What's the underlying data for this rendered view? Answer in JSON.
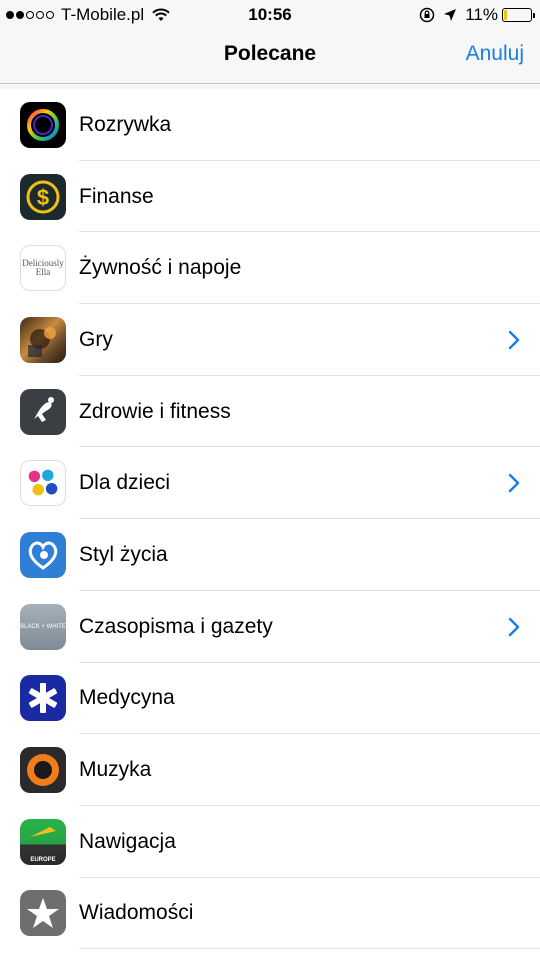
{
  "status_bar": {
    "carrier": "T-Mobile.pl",
    "time": "10:56",
    "battery": "11%",
    "battery_color": "#f5c400"
  },
  "nav": {
    "title": "Polecane",
    "cancel_label": "Anuluj",
    "accent_color": "#1a7ee6"
  },
  "categories": [
    {
      "label": "Rozrywka",
      "icon": "rozrywka-icon",
      "has_chevron": false
    },
    {
      "label": "Finanse",
      "icon": "dollar-coin-icon",
      "has_chevron": false
    },
    {
      "label": "Żywność i napoje",
      "icon": "deliciously-ella-icon",
      "icon_text": "Deliciously Ella",
      "has_chevron": false
    },
    {
      "label": "Gry",
      "icon": "game-character-icon",
      "has_chevron": true
    },
    {
      "label": "Zdrowie i fitness",
      "icon": "runner-icon",
      "has_chevron": false
    },
    {
      "label": "Dla dzieci",
      "icon": "handprints-icon",
      "has_chevron": true
    },
    {
      "label": "Styl życia",
      "icon": "heart-baby-icon",
      "has_chevron": false
    },
    {
      "label": "Czasopisma i gazety",
      "icon": "black-white-magazine-icon",
      "icon_text": "BLACK + WHITE",
      "has_chevron": true
    },
    {
      "label": "Medycyna",
      "icon": "star-of-life-icon",
      "has_chevron": false
    },
    {
      "label": "Muzyka",
      "icon": "speaker-ring-icon",
      "has_chevron": false
    },
    {
      "label": "Nawigacja",
      "icon": "europe-navigation-icon",
      "icon_text": "EUROPE",
      "has_chevron": false
    },
    {
      "label": "Wiadomości",
      "icon": "star-icon",
      "has_chevron": false
    }
  ]
}
